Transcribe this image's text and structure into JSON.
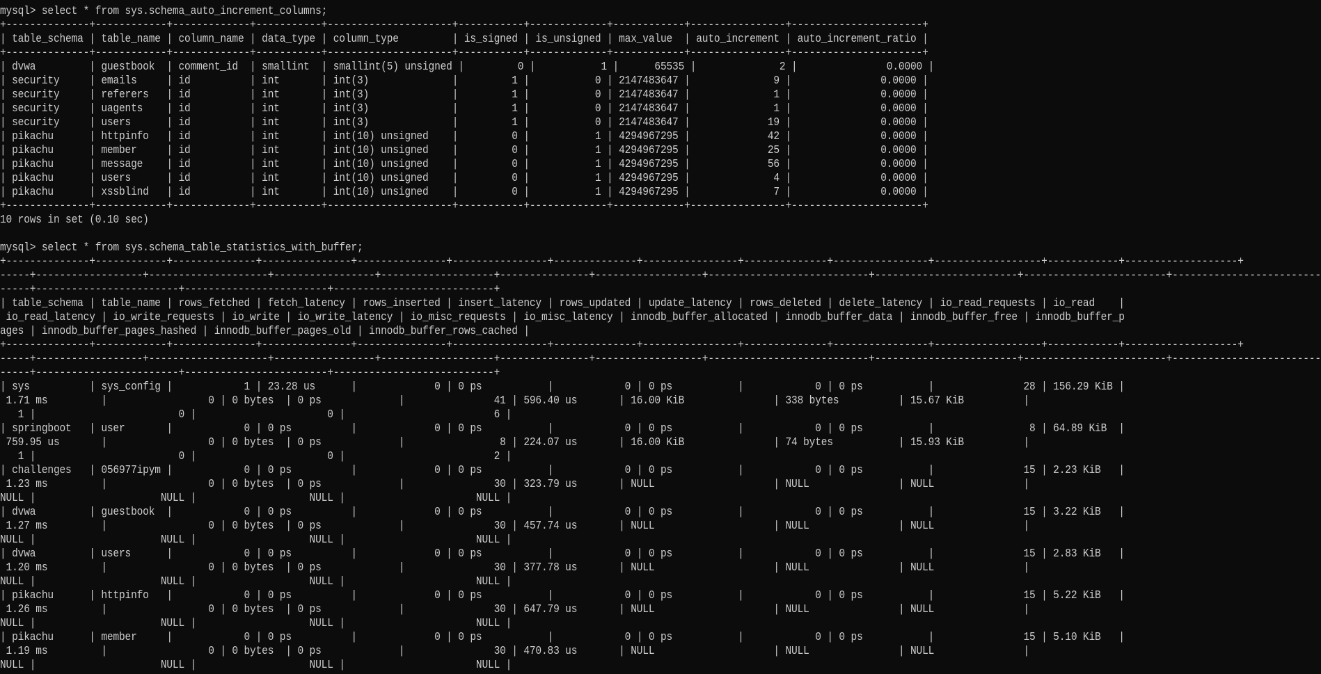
{
  "terminal": {
    "lines": [
      "mysql> select * from sys.schema_auto_increment_columns;",
      "+--------------+------------+-------------+-----------+---------------------+-----------+-------------+------------+----------------+----------------------+",
      "| table_schema | table_name | column_name | data_type | column_type         | is_signed | is_unsigned | max_value  | auto_increment | auto_increment_ratio |",
      "+--------------+------------+-------------+-----------+---------------------+-----------+-------------+------------+----------------+----------------------+",
      "| dvwa         | guestbook  | comment_id  | smallint  | smallint(5) unsigned |         0 |           1 |      65535 |              2 |               0.0000 |",
      "| security     | emails     | id          | int       | int(3)              |         1 |           0 | 2147483647 |              9 |               0.0000 |",
      "| security     | referers   | id          | int       | int(3)              |         1 |           0 | 2147483647 |              1 |               0.0000 |",
      "| security     | uagents    | id          | int       | int(3)              |         1 |           0 | 2147483647 |              1 |               0.0000 |",
      "| security     | users      | id          | int       | int(3)              |         1 |           0 | 2147483647 |             19 |               0.0000 |",
      "| pikachu      | httpinfo   | id          | int       | int(10) unsigned    |         0 |           1 | 4294967295 |             42 |               0.0000 |",
      "| pikachu      | member     | id          | int       | int(10) unsigned    |         0 |           1 | 4294967295 |             25 |               0.0000 |",
      "| pikachu      | message    | id          | int       | int(10) unsigned    |         0 |           1 | 4294967295 |             56 |               0.0000 |",
      "| pikachu      | users      | id          | int       | int(10) unsigned    |         0 |           1 | 4294967295 |              4 |               0.0000 |",
      "| pikachu      | xssblind   | id          | int       | int(10) unsigned    |         0 |           1 | 4294967295 |              7 |               0.0000 |",
      "+--------------+------------+-------------+-----------+---------------------+-----------+-------------+------------+----------------+----------------------+",
      "10 rows in set (0.10 sec)",
      "",
      "mysql> select * from sys.schema_table_statistics_with_buffer;",
      "+--------------+------------+--------------+---------------+---------------+----------------+--------------+----------------+--------------+----------------+------------------+------------+-------------------+",
      "-----+------------------+--------------------+-----------------+-------------------+---------------+------------------+---------------------------+------------------------+------------------------+-------------------------",
      "-----+------------------------+------------------------+---------------------------+",
      "| table_schema | table_name | rows_fetched | fetch_latency | rows_inserted | insert_latency | rows_updated | update_latency | rows_deleted | delete_latency | io_read_requests | io_read    |",
      " io_read_latency | io_write_requests | io_write | io_write_latency | io_misc_requests | io_misc_latency | innodb_buffer_allocated | innodb_buffer_data | innodb_buffer_free | innodb_buffer_p",
      "ages | innodb_buffer_pages_hashed | innodb_buffer_pages_old | innodb_buffer_rows_cached |",
      "+--------------+------------+--------------+---------------+---------------+----------------+--------------+----------------+--------------+----------------+------------------+------------+-------------------+",
      "-----+------------------+--------------------+-----------------+-------------------+---------------+------------------+---------------------------+------------------------+------------------------+-------------------------",
      "-----+------------------------+------------------------+---------------------------+",
      "| sys          | sys_config |            1 | 23.28 us      |             0 | 0 ps           |            0 | 0 ps           |            0 | 0 ps           |               28 | 156.29 KiB |",
      " 1.71 ms         |                 0 | 0 bytes  | 0 ps             |               41 | 596.40 us       | 16.00 KiB               | 338 bytes          | 15.67 KiB          |",
      "   1 |                        0 |                      0 |                         6 |",
      "| springboot   | user       |            0 | 0 ps          |             0 | 0 ps           |            0 | 0 ps           |            0 | 0 ps           |                8 | 64.89 KiB  |",
      " 759.95 us       |                 0 | 0 bytes  | 0 ps             |                8 | 224.07 us       | 16.00 KiB               | 74 bytes           | 15.93 KiB          |",
      "   1 |                        0 |                      0 |                         2 |",
      "| challenges   | 056977ipym |            0 | 0 ps          |             0 | 0 ps           |            0 | 0 ps           |            0 | 0 ps           |               15 | 2.23 KiB   |",
      " 1.23 ms         |                 0 | 0 bytes  | 0 ps             |               30 | 323.79 us       | NULL                    | NULL               | NULL               |",
      "NULL |                     NULL |                   NULL |                      NULL |",
      "| dvwa         | guestbook  |            0 | 0 ps          |             0 | 0 ps           |            0 | 0 ps           |            0 | 0 ps           |               15 | 3.22 KiB   |",
      " 1.27 ms         |                 0 | 0 bytes  | 0 ps             |               30 | 457.74 us       | NULL                    | NULL               | NULL               |",
      "NULL |                     NULL |                   NULL |                      NULL |",
      "| dvwa         | users      |            0 | 0 ps          |             0 | 0 ps           |            0 | 0 ps           |            0 | 0 ps           |               15 | 2.83 KiB   |",
      " 1.20 ms         |                 0 | 0 bytes  | 0 ps             |               30 | 377.78 us       | NULL                    | NULL               | NULL               |",
      "NULL |                     NULL |                   NULL |                      NULL |",
      "| pikachu      | httpinfo   |            0 | 0 ps          |             0 | 0 ps           |            0 | 0 ps           |            0 | 0 ps           |               15 | 5.22 KiB   |",
      " 1.26 ms         |                 0 | 0 bytes  | 0 ps             |               30 | 647.79 us       | NULL                    | NULL               | NULL               |",
      "NULL |                     NULL |                   NULL |                      NULL |",
      "| pikachu      | member     |            0 | 0 ps          |             0 | 0 ps           |            0 | 0 ps           |            0 | 0 ps           |               15 | 5.10 KiB   |",
      " 1.19 ms         |                 0 | 0 bytes  | 0 ps             |               30 | 470.83 us       | NULL                    | NULL               | NULL               |",
      "NULL |                     NULL |                   NULL |                      NULL |"
    ]
  }
}
